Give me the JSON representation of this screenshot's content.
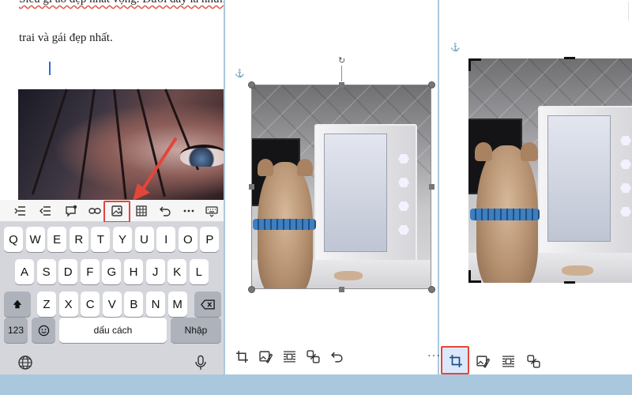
{
  "document": {
    "line_1": "Siêu gì ảo đẹp nhất vọng. Dưới đây là nhữn",
    "line_2": "trai và gái đẹp nhất."
  },
  "keyboard": {
    "row_1": [
      "Q",
      "W",
      "E",
      "R",
      "T",
      "Y",
      "U",
      "I",
      "O",
      "P"
    ],
    "row_2": [
      "A",
      "S",
      "D",
      "F",
      "G",
      "H",
      "J",
      "K",
      "L"
    ],
    "row_3": [
      "Z",
      "X",
      "C",
      "V",
      "B",
      "N",
      "M"
    ],
    "numbers_key": "123",
    "space_key": "dấu cách",
    "return_key": "Nhập"
  },
  "format_toolbar": {
    "icons": [
      "indent-icon",
      "outdent-icon",
      "comment-icon",
      "link-icon",
      "image-icon",
      "table-icon",
      "undo-icon",
      "more-icon",
      "keyboard-icon"
    ]
  },
  "picture_toolbar": {
    "icons": [
      "crop-icon",
      "picture-style-icon",
      "wrap-text-icon",
      "link-picture-icon",
      "undo-icon"
    ]
  },
  "colors": {
    "highlight": "#e2463b",
    "background": "#a9c8de",
    "crop_active": "#dbe8fb"
  }
}
